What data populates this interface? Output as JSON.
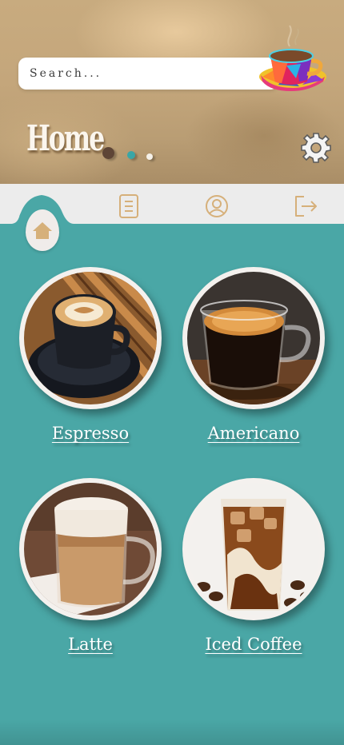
{
  "header": {
    "title": "Home",
    "search": {
      "placeholder": "Search...",
      "value": ""
    }
  },
  "nav": {
    "items": [
      {
        "icon": "home-icon",
        "active": true
      },
      {
        "icon": "document-icon",
        "active": false
      },
      {
        "icon": "profile-icon",
        "active": false
      },
      {
        "icon": "logout-icon",
        "active": false
      }
    ]
  },
  "menu": {
    "items": [
      {
        "label": "Espresso"
      },
      {
        "label": "Americano"
      },
      {
        "label": "Latte"
      },
      {
        "label": "Iced Coffee"
      }
    ]
  },
  "colors": {
    "accent": "#4aa7a6",
    "header": "#c4a67b",
    "nav_bg": "#ececec",
    "icon_tan": "#d6b07a"
  }
}
